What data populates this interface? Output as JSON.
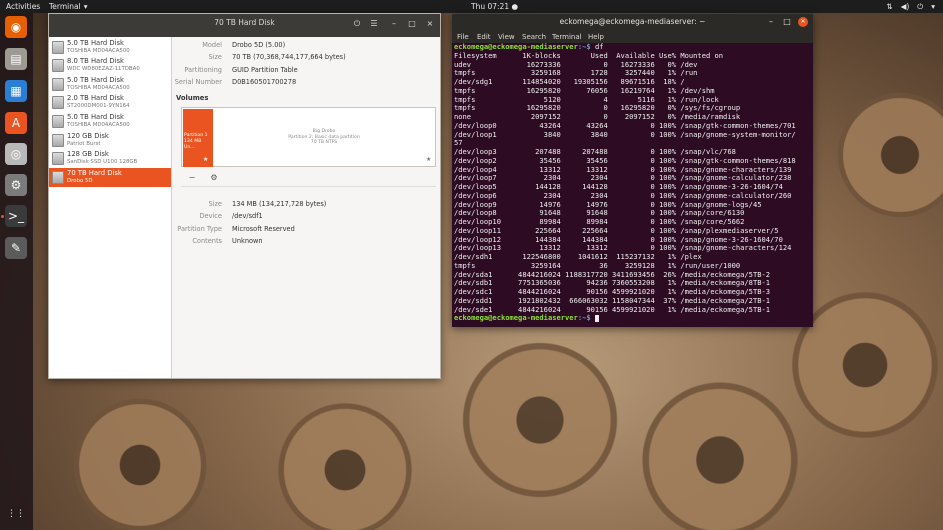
{
  "topbar": {
    "activities": "Activities",
    "app_name": "Terminal",
    "clock": "Thu 07:21"
  },
  "dock": {
    "apps": [
      {
        "name": "firefox-icon",
        "glyph": "◉",
        "color": "#e66000"
      },
      {
        "name": "files-icon",
        "glyph": "▤",
        "color": "#9d9a93"
      },
      {
        "name": "writer-icon",
        "glyph": "▦",
        "color": "#2a7fd4"
      },
      {
        "name": "software-icon",
        "glyph": "A",
        "color": "#e95420"
      },
      {
        "name": "disks-icon",
        "glyph": "◎",
        "color": "#b9b9b9"
      },
      {
        "name": "settings-icon",
        "glyph": "⚙",
        "color": "#7b7b7b"
      },
      {
        "name": "terminal-icon",
        "glyph": ">_",
        "color": "#3a3a3a"
      },
      {
        "name": "tool-icon",
        "glyph": "✎",
        "color": "#5b5b5b"
      }
    ],
    "show_apps": "⋮⋮"
  },
  "disks": {
    "title": "70 TB Hard Disk",
    "items": [
      {
        "name": "5.0 TB Hard Disk",
        "sub": "TOSHIBA MD04ACA500"
      },
      {
        "name": "8.0 TB Hard Disk",
        "sub": "WDC WD80EZAZ-11TDBA0"
      },
      {
        "name": "5.0 TB Hard Disk",
        "sub": "TOSHIBA MD04ACA500"
      },
      {
        "name": "2.0 TB Hard Disk",
        "sub": "ST2000DM001-9YN164"
      },
      {
        "name": "5.0 TB Hard Disk",
        "sub": "TOSHIBA MD04ACA500"
      },
      {
        "name": "120 GB Disk",
        "sub": "Patriot Burst"
      },
      {
        "name": "128 GB Disk",
        "sub": "SanDisk SSD U100 128GB"
      },
      {
        "name": "70 TB Hard Disk",
        "sub": "Drobo 5D"
      }
    ],
    "details": [
      {
        "key": "Model",
        "value": "Drobo 5D (5.00)"
      },
      {
        "key": "Size",
        "value": "70 TB (70,368,744,177,664 bytes)"
      },
      {
        "key": "Partitioning",
        "value": "GUID Partition Table"
      },
      {
        "key": "Serial Number",
        "value": "D0B160501700278"
      }
    ],
    "volumes_heading": "Volumes",
    "partition1": "Partition 1 134 MB Un…",
    "partition2_name": "Big Drobo",
    "partition2_desc": "Partition 2: Basic data partition",
    "partition2_size": "70 TB NTFS",
    "volume_details": [
      {
        "key": "Size",
        "value": "134 MB (134,217,728 bytes)"
      },
      {
        "key": "Device",
        "value": "/dev/sdf1"
      },
      {
        "key": "Partition Type",
        "value": "Microsoft Reserved"
      },
      {
        "key": "Contents",
        "value": "Unknown"
      }
    ]
  },
  "terminal": {
    "title": "eckomega@eckomega-mediaserver: ~",
    "menu": [
      "File",
      "Edit",
      "View",
      "Search",
      "Terminal",
      "Help"
    ],
    "prompt_user": "eckomega@eckomega-mediaserver",
    "prompt_path": ":~$",
    "command": " df",
    "output": [
      "Filesystem      1K-blocks       Used  Available Use% Mounted on",
      "udev             16273336          0   16273336   0% /dev",
      "tmpfs             3259168       1728    3257440   1% /run",
      "/dev/sdg1       114854020   19305156   89671516  18% /",
      "tmpfs            16295820      76056   16219764   1% /dev/shm",
      "tmpfs                5120          4       5116   1% /run/lock",
      "tmpfs            16295820          0   16295820   0% /sys/fs/cgroup",
      "none              2097152          0    2097152   0% /media/ramdisk",
      "/dev/loop0          43264      43264          0 100% /snap/gtk-common-themes/701",
      "/dev/loop1           3840       3840          0 100% /snap/gnome-system-monitor/",
      "57",
      "/dev/loop3         207488     207488          0 100% /snap/vlc/768",
      "/dev/loop2          35456      35456          0 100% /snap/gtk-common-themes/818",
      "/dev/loop4          13312      13312          0 100% /snap/gnome-characters/139",
      "/dev/loop7           2304       2304          0 100% /snap/gnome-calculator/238",
      "/dev/loop5         144128     144128          0 100% /snap/gnome-3-26-1604/74",
      "/dev/loop6           2304       2304          0 100% /snap/gnome-calculator/260",
      "/dev/loop9          14976      14976          0 100% /snap/gnome-logs/45",
      "/dev/loop8          91648      91648          0 100% /snap/core/6130",
      "/dev/loop10         89984      89984          0 100% /snap/core/5662",
      "/dev/loop11        225664     225664          0 100% /snap/plexmediaserver/5",
      "/dev/loop12        144384     144384          0 100% /snap/gnome-3-26-1604/70",
      "/dev/loop13         13312      13312          0 100% /snap/gnome-characters/124",
      "/dev/sdh1       122546800    1041612  115237132   1% /plex",
      "tmpfs             3259164         36    3259128   1% /run/user/1000",
      "/dev/sda1      4844216024 1188317720 3411693456  26% /media/eckomega/5TB-2",
      "/dev/sdb1      7751365036      94236 7360553208   1% /media/eckomega/8TB-1",
      "/dev/sdc1      4844216024      90156 4599921020   1% /media/eckomega/5TB-3",
      "/dev/sdd1      1921802432  666063032 1158047344  37% /media/eckomega/2TB-1",
      "/dev/sde1      4844216024      90156 4599921020   1% /media/eckomega/5TB-1"
    ]
  }
}
